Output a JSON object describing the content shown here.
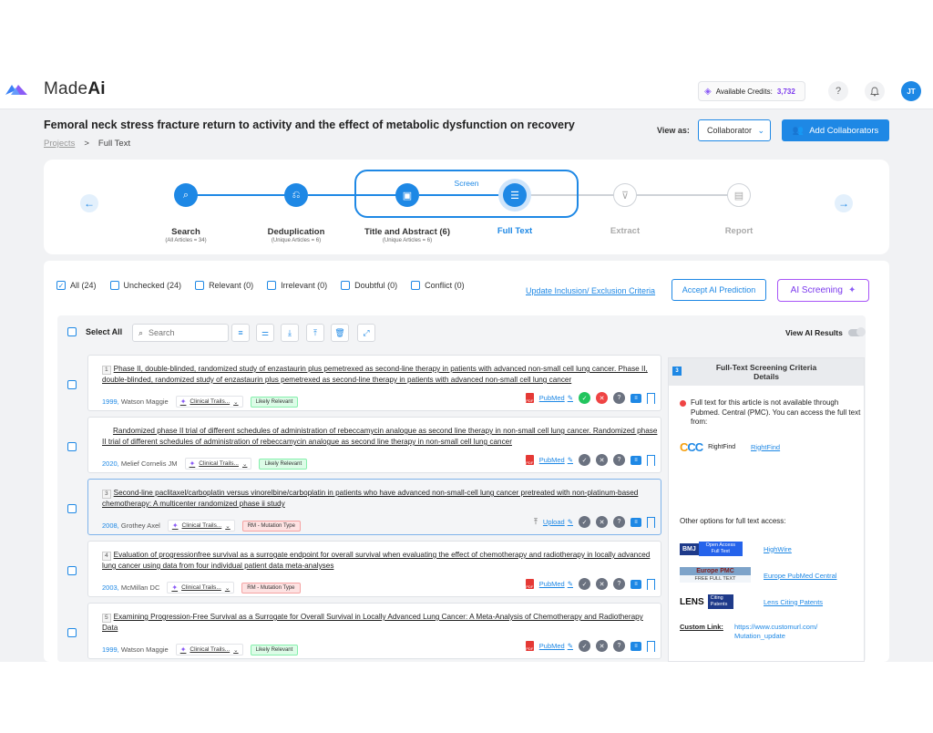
{
  "app": {
    "logo_prefix": "Made",
    "logo_suffix": "Ai",
    "credits_label": "Available Credits:",
    "credits_value": "3,732",
    "user_initials": "JT"
  },
  "header": {
    "title": "Femoral neck stress fracture return to activity and the effect of metabolic dysfunction on recovery",
    "breadcrumb_projects": "Projects",
    "breadcrumb_sep": ">",
    "breadcrumb_current": "Full Text",
    "view_as_label": "View as:",
    "view_as_value": "Collaborator",
    "add_collaborators_label": "Add Collaborators"
  },
  "stepper": {
    "group_label": "Screen",
    "steps": [
      {
        "name": "Search",
        "sub": "(All Articles = 34)"
      },
      {
        "name": "Deduplication",
        "sub": "(Unique Articles = 6)"
      },
      {
        "name": "Title and Abstract (6)",
        "sub": "(Unique Articles = 6)"
      },
      {
        "name": "Full Text",
        "sub": ""
      },
      {
        "name": "Extract",
        "sub": ""
      },
      {
        "name": "Report",
        "sub": ""
      }
    ]
  },
  "filters": {
    "all": "All (24)",
    "unchecked": "Unchecked (24)",
    "relevant": "Relevant (0)",
    "irrelevant": "Irrelevant (0)",
    "doubtful": "Doubtful (0)",
    "conflict": "Conflict (0)",
    "update_criteria": "Update Inclusion/ Exclusion Criteria",
    "accept_ai": "Accept AI Prediction",
    "ai_screening": "AI Screening"
  },
  "toolbar": {
    "select_all": "Select All",
    "search_placeholder": "Search",
    "view_ai_results": "View AI Results"
  },
  "articles": [
    {
      "num": "1",
      "title": "Phase II, double-blinded, randomized study of enzastaurin plus pemetrexed as second-line therapy in patients with advanced non-small cell lung cancer. Phase II, double-blinded, randomized study of enzastaurin plus pemetrexed as second-line therapy in patients with advanced non-small cell lung cancer",
      "year": "1999,",
      "author": "Watson Maggie",
      "trial": "Clinical Trails...",
      "tag": "Likely Relevant",
      "link": "PubMed"
    },
    {
      "num": "",
      "title": "Randomized phase II trial of different schedules of administration of rebeccamycin analogue as second line therapy in non-small cell lung cancer. Randomized phase II trial of different schedules of administration of rebeccamycin analogue as second line therapy in non-small cell lung cancer",
      "year": "2020,",
      "author": "Melief Cornelis JM",
      "trial": "Clinical Trails...",
      "tag": "Likely Relevant",
      "link": "PubMed"
    },
    {
      "num": "3",
      "title": "Second-line paclitaxel/carboplatin versus vinorelbine/carboplatin in patients who have advanced non-small-cell lung cancer pretreated with non-platinum-based chemotherapy: A multicenter randomized phase ii study",
      "year": "2008,",
      "author": "Grothey Axel",
      "trial": "Clinical Trails...",
      "tag": "RM - Mutation Type",
      "link": "Upload"
    },
    {
      "num": "4",
      "title": "Evaluation of progressionfree survival as a surrogate endpoint for overall survival when evaluating the effect of chemotherapy and radiotherapy in locally advanced lung cancer using data from four individual patient data meta-analyses",
      "year": "2003,",
      "author": "McMillan DC",
      "trial": "Clinical Trails...",
      "tag": "RM - Mutation Type",
      "link": "PubMed"
    },
    {
      "num": "5",
      "title": "Examining Progression-Free Survival as a Surrogate for Overall Survival in Locally Advanced Lung Cancer: A Meta-Analysis of Chemotherapy and Radiotherapy Data",
      "year": "1999,",
      "author": "Watson Maggie",
      "trial": "Clinical Trails...",
      "tag": "Likely Relevant",
      "link": "PubMed"
    }
  ],
  "criteria": {
    "num": "3",
    "title_line1": "Full-Text Screening Criteria",
    "title_line2": "Details",
    "message": "Full text for this article is not available through Pubmed. Central (PMC). You can access the full text from:",
    "rightfind_logo": "RightFind",
    "rightfind_link": "RightFind",
    "other_options": "Other options for full text access:",
    "highwire_logo_a": "BMJ",
    "highwire_logo_b": "Open Access Full Text",
    "highwire_link": "HighWire",
    "epmc_logo_a": "Europe PMC",
    "epmc_logo_b": "FREE FULL TEXT",
    "epmc_link": "Europe PubMed Central",
    "lens_logo_a": "LENS",
    "lens_logo_b": "Citing Patents",
    "lens_link": "Lens Citing Patents",
    "custom_label": "Custom Link:",
    "custom_url": "https://www.customurl.com/ Mutation_update"
  }
}
